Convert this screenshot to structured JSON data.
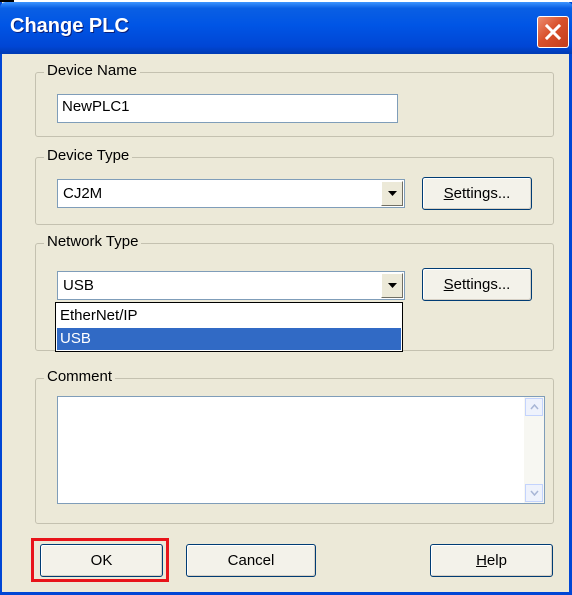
{
  "window": {
    "title": "Change PLC"
  },
  "device_name": {
    "legend": "Device Name",
    "value": "NewPLC1"
  },
  "device_type": {
    "legend": "Device Type",
    "selected": "CJ2M",
    "settings_label": "Settings...",
    "settings_accel": "S",
    "settings_rest": "ettings..."
  },
  "network_type": {
    "legend": "Network Type",
    "selected": "USB",
    "settings_label": "Settings...",
    "settings_accel": "S",
    "settings_rest": "ettings...",
    "options": [
      "EtherNet/IP",
      "USB"
    ],
    "highlighted_option": "USB"
  },
  "comment": {
    "legend": "Comment",
    "value": ""
  },
  "buttons": {
    "ok": "OK",
    "cancel": "Cancel",
    "help_accel": "H",
    "help_rest": "elp",
    "help": "Help"
  },
  "colors": {
    "title_bar": "#0055e5",
    "selection": "#316ac5",
    "highlight_box": "#e8141a",
    "dialog_bg": "#ece9d8"
  },
  "icons": {
    "close": "close-icon",
    "dropdown_arrow": "chevron-down-icon",
    "scroll_up": "scroll-up-arrow-icon",
    "scroll_down": "scroll-down-arrow-icon"
  }
}
